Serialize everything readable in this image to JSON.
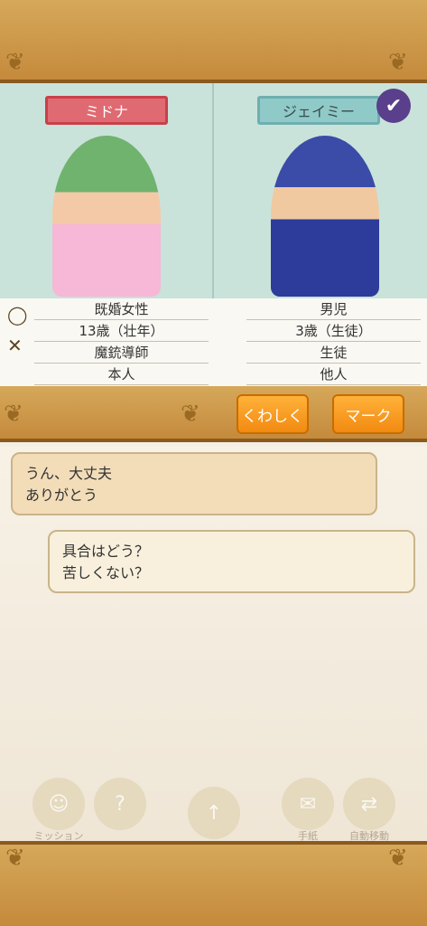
{
  "characters": {
    "left": {
      "name": "ミドナ"
    },
    "right": {
      "name": "ジェイミー"
    }
  },
  "stats": {
    "left": [
      "既婚女性",
      "13歳（壮年）",
      "魔銃導師",
      "本人"
    ],
    "right": [
      "男児",
      "3歳（生徒）",
      "生徒",
      "他人"
    ]
  },
  "buttons": {
    "detail": "くわしく",
    "mark": "マーク"
  },
  "dialogue": {
    "bubble_1": [
      "うん、大丈夫",
      "ありがとう"
    ],
    "bubble_2": [
      "具合はどう？",
      "苦しくない？"
    ]
  },
  "bottom_menu": [
    "ミッション",
    "?",
    "↑",
    "手紙",
    "自動移動"
  ],
  "icons": {
    "ring": "ring-icon",
    "cross": "cross-icon",
    "check": "check-icon"
  },
  "colors": {
    "frame": "#c58a3c",
    "panel": "#c9e3da",
    "button": "#f28a10",
    "name_left": "#e06a72",
    "name_right": "#8fcac9"
  }
}
